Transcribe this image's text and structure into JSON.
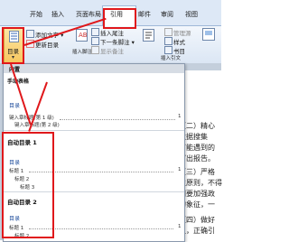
{
  "ribbon": {
    "tabs": [
      "开始",
      "插入",
      "页面布局",
      "引用",
      "邮件",
      "审阅",
      "视图"
    ],
    "active_tab": "引用",
    "toc_group": {
      "button_label": "目录",
      "add_text": "添加文字",
      "update_toc": "更新目录"
    },
    "footnote_group": {
      "insert_footnote": "插入脚注",
      "next_footnote": "下一条脚注",
      "show_notes": "显示备注"
    },
    "citation_group": {
      "manage_sources": "管理源",
      "style": "样式",
      "bibliography": "书目"
    },
    "caption_group": {
      "insert_citation": "插入引文"
    }
  },
  "dropdown": {
    "header": "内置",
    "sections": [
      {
        "name": "手动表格",
        "toc_title": "目录",
        "lines": [
          "键入章标题(第 1 级)",
          "键入章标题(第 2 级)"
        ],
        "page": "1"
      },
      {
        "name": "自动目录 1",
        "toc_title": "目录",
        "lines": [
          "标题 1",
          "标题 2",
          "标题 3"
        ],
        "page": "1"
      },
      {
        "name": "自动目录 2",
        "toc_title": "目录",
        "lines": [
          "标题 1",
          "标题 2"
        ],
        "page": "1"
      }
    ]
  },
  "document": {
    "lines": [
      "（二）精心",
      "数据搜集",
      "可能遇到的",
      "写出报告。",
      "（三）严格",
      "性原则，不得",
      "门要加强政",
      "的象征，一",
      "（四）做好",
      "又，正确引"
    ]
  }
}
